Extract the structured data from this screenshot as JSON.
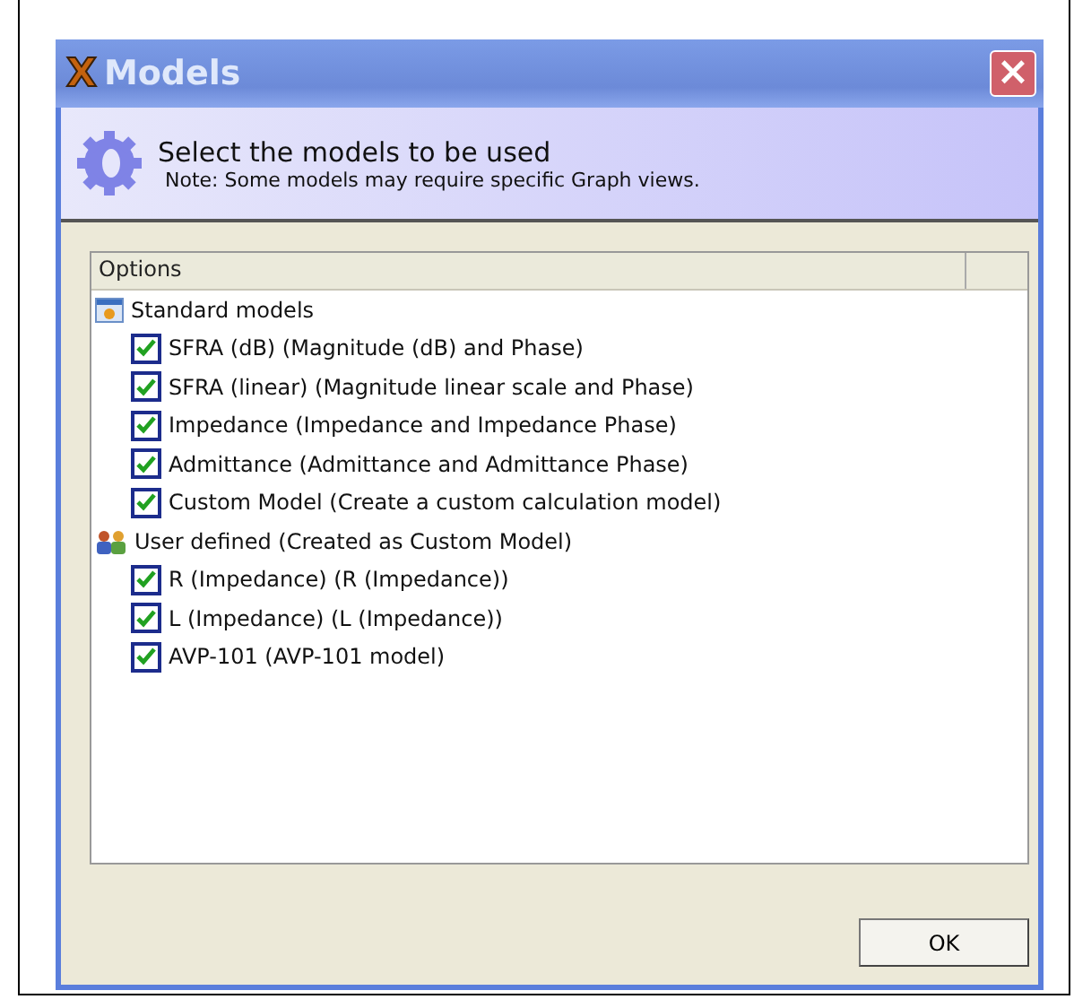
{
  "window": {
    "logo": "X",
    "title": "Models",
    "close": "×"
  },
  "header": {
    "title": "Select the models to be used",
    "note": "Note: Some models may require specific Graph views."
  },
  "table": {
    "columns": [
      "Options"
    ],
    "groups": [
      {
        "kind": "standard",
        "label": "Standard models",
        "children": [
          {
            "label": "SFRA (dB) (Magnitude (dB) and Phase)",
            "checked": true
          },
          {
            "label": "SFRA (linear) (Magnitude linear scale and Phase)",
            "checked": true
          },
          {
            "label": "Impedance (Impedance and Impedance Phase)",
            "checked": true
          },
          {
            "label": "Admittance (Admittance and Admittance Phase)",
            "checked": true
          },
          {
            "label": "Custom Model (Create a custom calculation model)",
            "checked": true
          }
        ]
      },
      {
        "kind": "user",
        "label": "User defined (Created as Custom Model)",
        "children": [
          {
            "label": "R (Impedance) (R (Impedance))",
            "checked": true
          },
          {
            "label": "L (Impedance) (L (Impedance))",
            "checked": true
          },
          {
            "label": "AVP-101 (AVP-101 model)",
            "checked": true
          }
        ]
      }
    ]
  },
  "buttons": [
    "OK"
  ]
}
